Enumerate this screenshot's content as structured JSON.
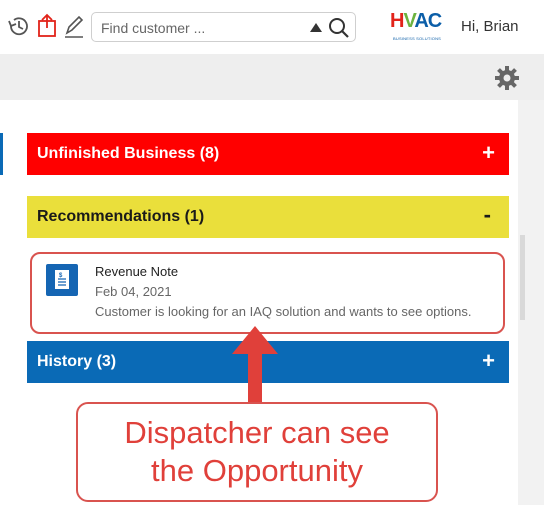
{
  "header": {
    "search": {
      "placeholder": "Find customer ...",
      "value": ""
    },
    "logo": {
      "text_h": "H",
      "text_v": "V",
      "text_ac": "AC",
      "tagline": "BUSINESS SOLUTIONS"
    },
    "greeting": "Hi, Brian",
    "icons": [
      "history-icon",
      "share-icon",
      "edit-icon",
      "caret-up-icon",
      "search-icon"
    ]
  },
  "subbar": {
    "icons": [
      "gear-icon"
    ]
  },
  "sections": {
    "unfinished": {
      "title": "Unfinished Business (8)",
      "toggle": "+",
      "color": "#ff0000"
    },
    "recommendations": {
      "title": "Recommendations (1)",
      "toggle": "-",
      "color": "#eadf3b",
      "items": [
        {
          "icon": "note-icon",
          "title": "Revenue Note",
          "date": "Feb 04, 2021",
          "description": "Customer is looking for an IAQ solution and wants to see options."
        }
      ]
    },
    "history": {
      "title": "History (3)",
      "toggle": "+",
      "color": "#0a6ab6"
    }
  },
  "callout": {
    "line1": "Dispatcher can see",
    "line2": "the Opportunity",
    "color": "#e0403a"
  }
}
